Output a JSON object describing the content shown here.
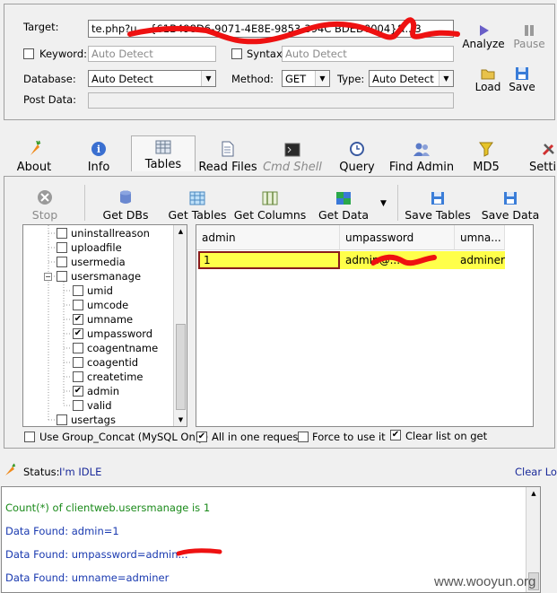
{
  "top_panel": {
    "target_label": "Target:",
    "target_value": "te.php?u... {61B498D6-9071-4E8E-9853-394C BDED0004}&...3",
    "keyword_label": "Keyword:",
    "keyword_placeholder": "Auto Detect",
    "syntax_label": "Syntax:",
    "syntax_placeholder": "Auto Detect",
    "database_label": "Database:",
    "database_value": "Auto Detect",
    "method_label": "Method:",
    "method_value": "GET",
    "type_label": "Type:",
    "type_value": "Auto Detect",
    "postdata_label": "Post Data:",
    "analyze_label": "Analyze",
    "pause_label": "Pause",
    "load_label": "Load",
    "save_label": "Save"
  },
  "toolbar": [
    {
      "label": "About"
    },
    {
      "label": "Info"
    },
    {
      "label": "Tables"
    },
    {
      "label": "Read Files"
    },
    {
      "label": "Cmd Shell"
    },
    {
      "label": "Query"
    },
    {
      "label": "Find Admin"
    },
    {
      "label": "MD5"
    },
    {
      "label": "Setti"
    }
  ],
  "tables_toolbar": [
    {
      "label": "Stop"
    },
    {
      "label": "Get DBs"
    },
    {
      "label": "Get Tables"
    },
    {
      "label": "Get Columns"
    },
    {
      "label": "Get Data"
    },
    {
      "label": "Save Tables"
    },
    {
      "label": "Save Data"
    }
  ],
  "tree": [
    {
      "label": "uninstallreason",
      "checked": false
    },
    {
      "label": "uploadfile",
      "checked": false
    },
    {
      "label": "usermedia",
      "checked": false
    },
    {
      "label": "usersmanage",
      "checked": false
    },
    {
      "label": "umid",
      "checked": false
    },
    {
      "label": "umcode",
      "checked": false
    },
    {
      "label": "umname",
      "checked": true
    },
    {
      "label": "umpassword",
      "checked": true
    },
    {
      "label": "coagentname",
      "checked": false
    },
    {
      "label": "coagentid",
      "checked": false
    },
    {
      "label": "createtime",
      "checked": false
    },
    {
      "label": "admin",
      "checked": true
    },
    {
      "label": "valid",
      "checked": false
    },
    {
      "label": "usertags",
      "checked": false
    }
  ],
  "grid": {
    "headers": [
      "admin",
      "umpassword",
      "umna..."
    ],
    "row": [
      "1",
      "admin@...",
      "adminer"
    ]
  },
  "options": {
    "group_concat": "Use Group_Concat (MySQL Only)",
    "all_in_one": "All in one request.",
    "force": "Force to use it",
    "clear_list": "Clear list on get"
  },
  "status": {
    "label": "Status:",
    "value": "I'm IDLE",
    "clear_log": "Clear Log"
  },
  "log": [
    {
      "text": "Count(*) of clientweb.usersmanage is 1",
      "color": "#1a8a1a"
    },
    {
      "text": "Data Found: admin=1",
      "color": "#1a3ab0"
    },
    {
      "text": "Data Found: umpassword=admin...",
      "color": "#1a3ab0"
    },
    {
      "text": "Data Found: umname=adminer",
      "color": "#1a3ab0"
    }
  ],
  "watermark": "www.wooyun.org"
}
